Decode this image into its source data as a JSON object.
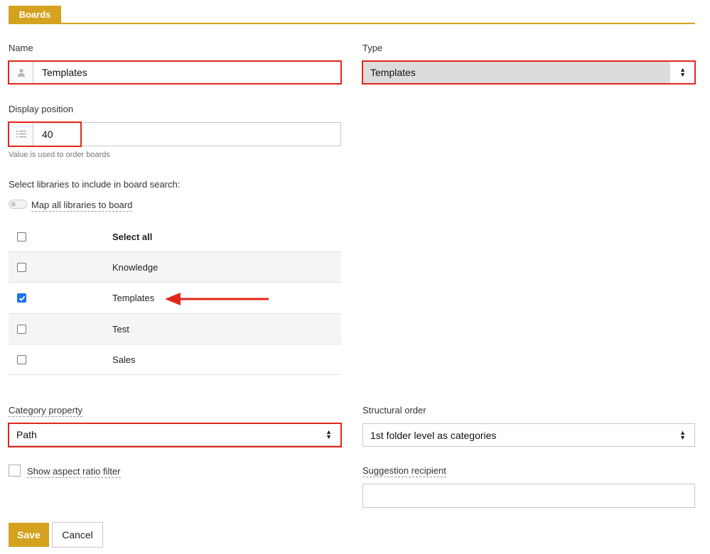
{
  "tab": {
    "label": "Boards"
  },
  "name_field": {
    "label": "Name",
    "value": "Templates",
    "icon": "user-icon"
  },
  "type_field": {
    "label": "Type",
    "value": "Templates"
  },
  "display_position": {
    "label": "Display position",
    "value": "40",
    "help": "Value is used to order boards",
    "icon": "ordered-list-icon"
  },
  "libraries": {
    "label": "Select libraries to include in board search:",
    "map_all_label": "Map all libraries to board",
    "select_all_label": "Select all",
    "items": [
      {
        "label": "Knowledge",
        "checked": false
      },
      {
        "label": "Templates",
        "checked": true
      },
      {
        "label": "Test",
        "checked": false
      },
      {
        "label": "Sales",
        "checked": false
      }
    ]
  },
  "category_property": {
    "label": "Category property",
    "value": "Path"
  },
  "structural_order": {
    "label": "Structural order",
    "value": "1st folder level as categories"
  },
  "aspect_ratio": {
    "label": "Show aspect ratio filter"
  },
  "suggestion_recipient": {
    "label": "Suggestion recipient",
    "value": ""
  },
  "actions": {
    "save": "Save",
    "cancel": "Cancel"
  },
  "colors": {
    "accent": "#d4a21e",
    "highlight": "#e0281a",
    "checkbox": "#1a73e8"
  }
}
